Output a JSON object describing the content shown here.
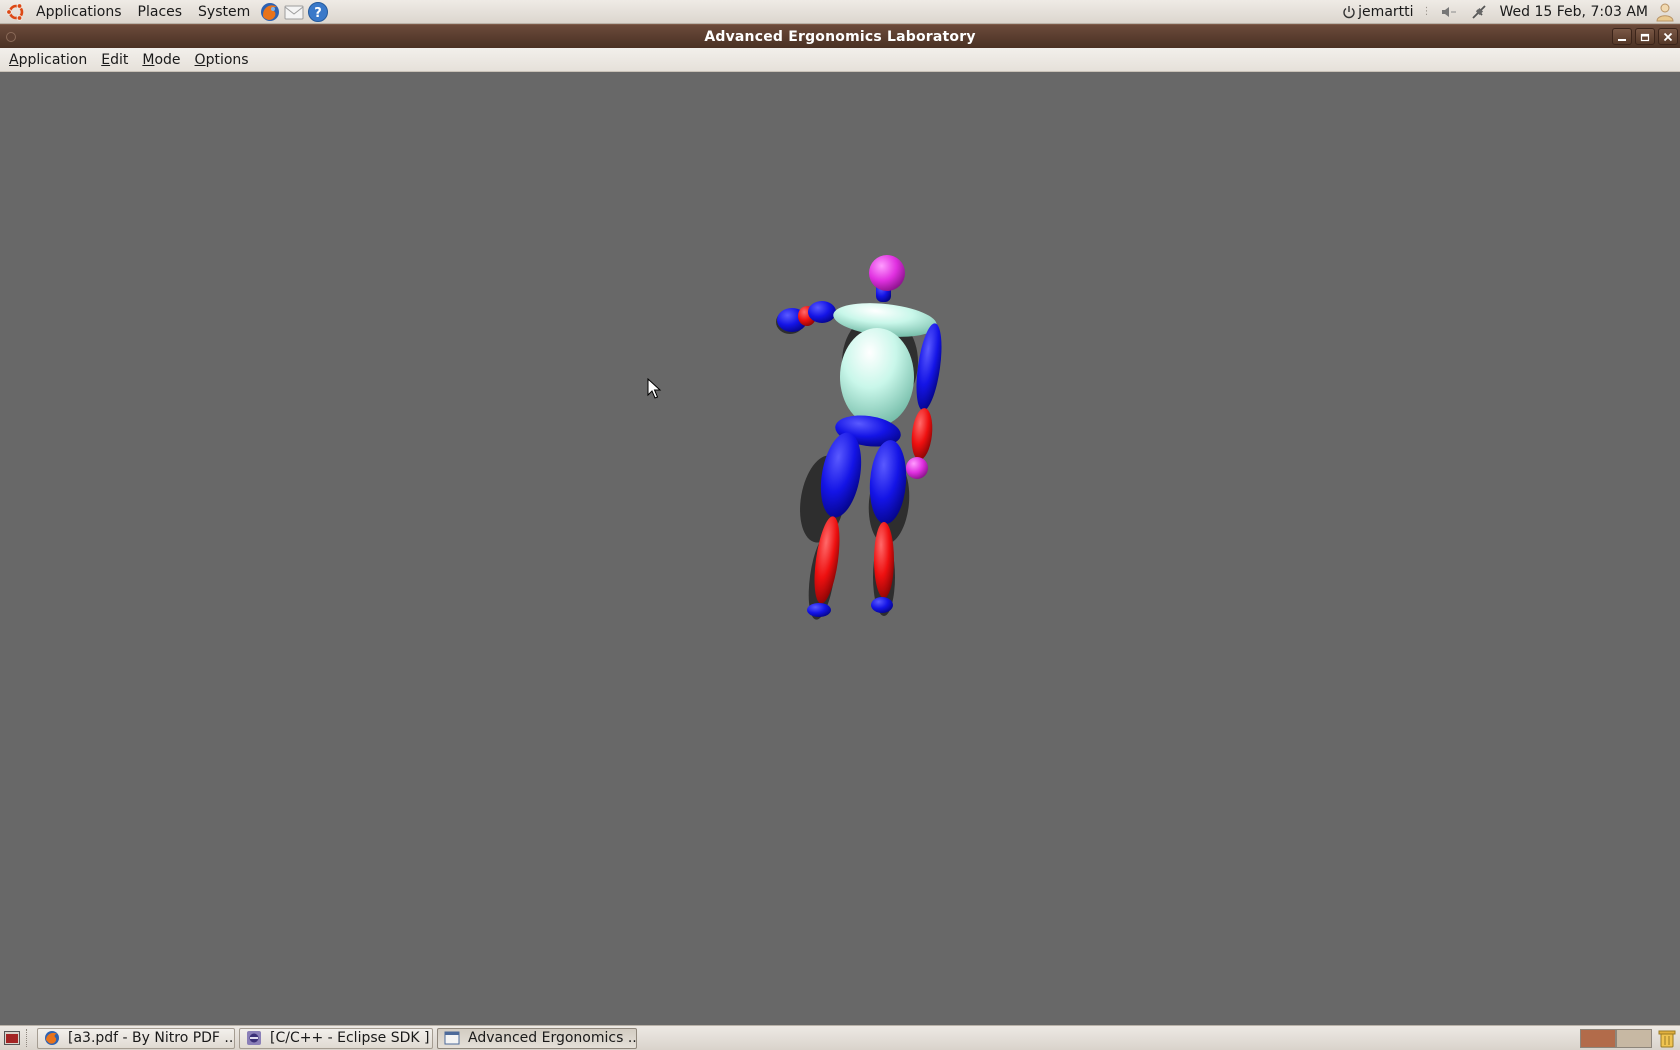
{
  "top_panel": {
    "menus": [
      "Applications",
      "Places",
      "System"
    ],
    "user": "jemartti",
    "clock": "Wed 15 Feb,  7:03 AM"
  },
  "window": {
    "title": "Advanced Ergonomics Laboratory"
  },
  "menubar": {
    "items": [
      "Application",
      "Edit",
      "Mode",
      "Options"
    ]
  },
  "colors": {
    "viewport_bg": "#686868",
    "limb_blue": "#1414e6",
    "limb_red": "#ee1010",
    "joint_magenta": "#e030e0",
    "torso_mint": "#b8f0e0",
    "titlebar": "#5a3c2e"
  },
  "taskbar": {
    "tasks": [
      {
        "label": "[a3.pdf - By Nitro PDF ...",
        "icon": "firefox-icon"
      },
      {
        "label": "[C/C++ - Eclipse SDK ]",
        "icon": "eclipse-icon"
      },
      {
        "label": "Advanced Ergonomics ...",
        "icon": "window-icon"
      }
    ]
  }
}
